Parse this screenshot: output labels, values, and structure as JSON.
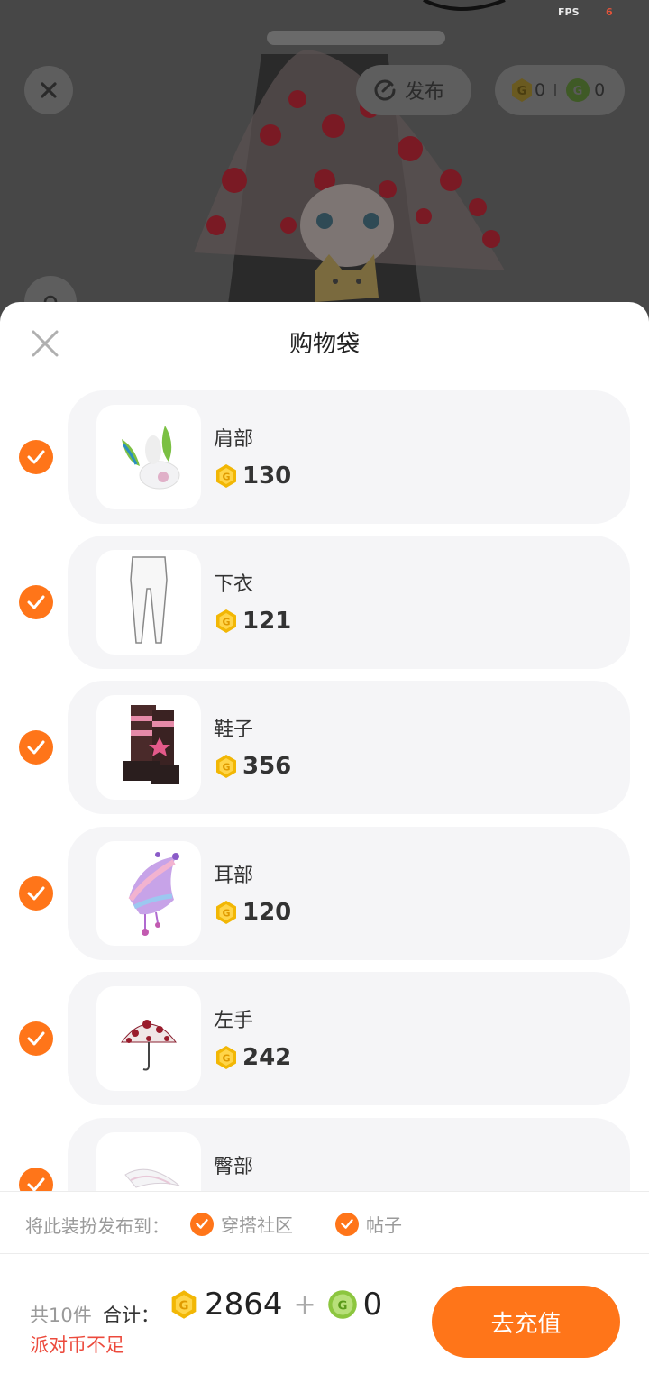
{
  "topbar": {
    "fps_label": "FPS",
    "fps_value": "6",
    "publish_label": "发布",
    "gold_coins": "0",
    "green_coins": "0"
  },
  "sheet": {
    "title": "购物袋",
    "items": [
      {
        "name": "肩部",
        "price": "130",
        "checked": true
      },
      {
        "name": "下衣",
        "price": "121",
        "checked": true
      },
      {
        "name": "鞋子",
        "price": "356",
        "checked": true
      },
      {
        "name": "耳部",
        "price": "120",
        "checked": true
      },
      {
        "name": "左手",
        "price": "242",
        "checked": true
      },
      {
        "name": "臀部",
        "price": "",
        "checked": true
      }
    ]
  },
  "publish_to": {
    "label": "将此装扮发布到：",
    "options": [
      {
        "label": "穿搭社区",
        "checked": true
      },
      {
        "label": "帖子",
        "checked": true
      }
    ]
  },
  "footer": {
    "count": "共10件",
    "total_label": "合计：",
    "gold_total": "2864",
    "plus": "+",
    "green_total": "0",
    "warning": "派对币不足",
    "recharge_label": "去充值"
  },
  "colors": {
    "accent": "#ff7519",
    "warning": "#ec4a3c",
    "gold_coin": "#f2b705",
    "green_coin": "#8cc63f"
  },
  "icons": {
    "gold_coin": "gold-coin-icon",
    "green_coin": "green-coin-icon",
    "check": "check-icon",
    "close": "close-icon",
    "publish": "refresh-circle-icon",
    "camera": "camera-icon"
  }
}
